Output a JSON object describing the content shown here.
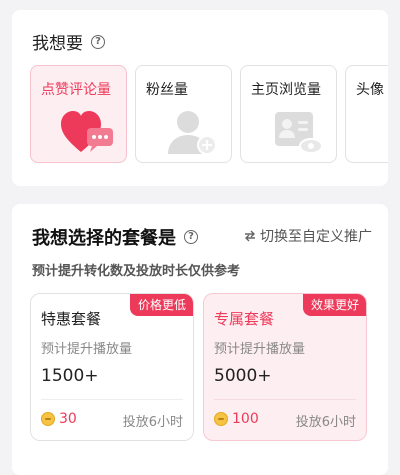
{
  "goal_section": {
    "title": "我想要",
    "help_icon": "question-circle-icon",
    "options": [
      {
        "label": "点赞评论量",
        "icon": "heart-comment-icon",
        "selected": true
      },
      {
        "label": "粉丝量",
        "icon": "person-plus-icon",
        "selected": false
      },
      {
        "label": "主页浏览量",
        "icon": "profile-card-view-icon",
        "selected": false
      },
      {
        "label": "头像",
        "icon": "",
        "selected": false
      }
    ]
  },
  "plan_section": {
    "title": "我想选择的套餐是",
    "help_icon": "question-circle-icon",
    "switch_link": "切换至自定义推广",
    "switch_icon": "swap-arrows-icon",
    "subtitle": "预计提升转化数及投放时长仅供参考",
    "packages": [
      {
        "tag": "价格更低",
        "name": "特惠套餐",
        "metric": "预计提升播放量",
        "value": "1500+",
        "price": "30",
        "duration": "投放6小时",
        "selected": false
      },
      {
        "tag": "效果更好",
        "name": "专属套餐",
        "metric": "预计提升播放量",
        "value": "5000+",
        "price": "100",
        "duration": "投放6小时",
        "selected": true
      }
    ]
  },
  "colors": {
    "accent": "#ee3a5a",
    "selected_bg": "#fdeef1",
    "coin": "#f6c343"
  }
}
